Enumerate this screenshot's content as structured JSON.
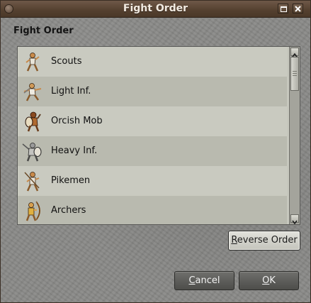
{
  "window": {
    "title": "Fight Order",
    "controls": {
      "maximize": "maximize",
      "close": "close"
    }
  },
  "dialog": {
    "heading": "Fight Order",
    "units": [
      {
        "label": "Scouts",
        "icon": "scout-icon"
      },
      {
        "label": "Light Inf.",
        "icon": "light-infantry-icon"
      },
      {
        "label": "Orcish Mob",
        "icon": "orcish-mob-icon"
      },
      {
        "label": "Heavy Inf.",
        "icon": "heavy-infantry-icon"
      },
      {
        "label": "Pikemen",
        "icon": "pikemen-icon"
      },
      {
        "label": "Archers",
        "icon": "archers-icon"
      }
    ],
    "buttons": {
      "reverse": "Reverse Order",
      "cancel": "Cancel",
      "ok": "OK"
    }
  },
  "colors": {
    "titlebar": "#54402f",
    "list_row_light": "#c9cac0",
    "list_row_dark": "#b9baaf",
    "dark_button": "#5a5a57"
  }
}
